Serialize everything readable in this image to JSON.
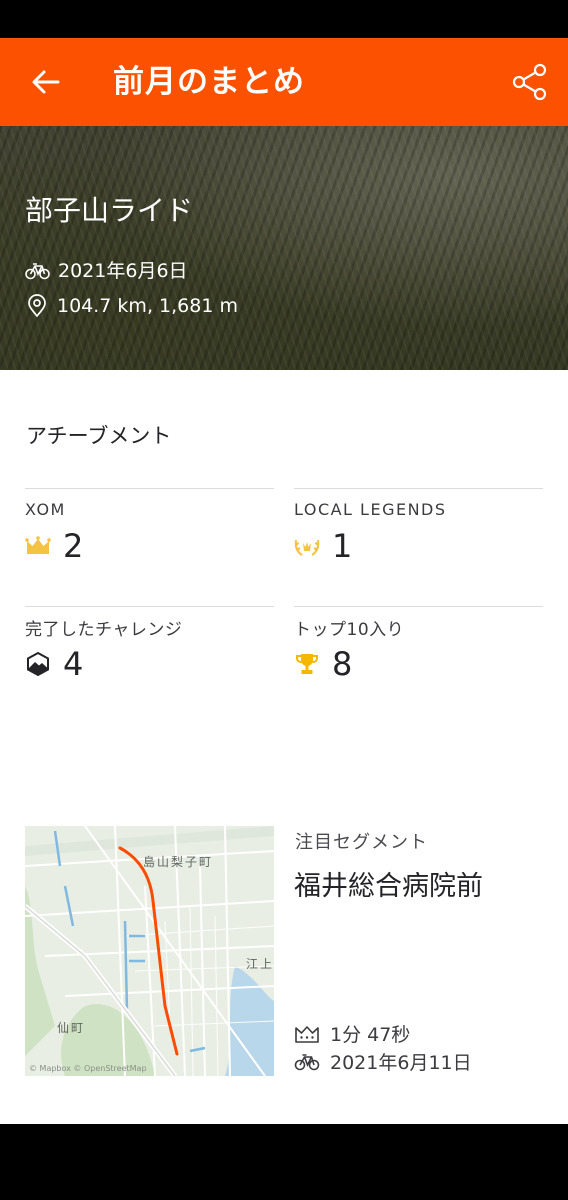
{
  "app_bar": {
    "title": "前月のまとめ",
    "back_icon": "arrow-left-icon",
    "share_icon": "share-icon"
  },
  "hero": {
    "activity_name": "部子山ライド",
    "date": "2021年6月6日",
    "distance_elevation": "104.7 km, 1,681 m"
  },
  "achievements": {
    "title": "アチーブメント",
    "items": [
      {
        "label": "XOM",
        "value": "2",
        "icon": "crown-icon",
        "color": "#f5c343"
      },
      {
        "label": "LOCAL LEGENDS",
        "value": "1",
        "icon": "laurel-icon",
        "color": "#f5c343"
      },
      {
        "label": "完了したチャレンジ",
        "value": "4",
        "icon": "challenge-badge-icon",
        "color": "#242428"
      },
      {
        "label": "トップ10入り",
        "value": "8",
        "icon": "trophy-icon",
        "color": "#f5b800"
      }
    ]
  },
  "featured_segment": {
    "label": "注目セグメント",
    "name": "福井総合病院前",
    "time": "1分 47秒",
    "date": "2021年6月11日",
    "map_labels": [
      "島山梨子町",
      "江上",
      "仙町"
    ],
    "map_attribution": "© Mapbox © OpenStreetMap",
    "route_color": "#fc4c02"
  },
  "colors": {
    "accent": "#fc5200"
  }
}
